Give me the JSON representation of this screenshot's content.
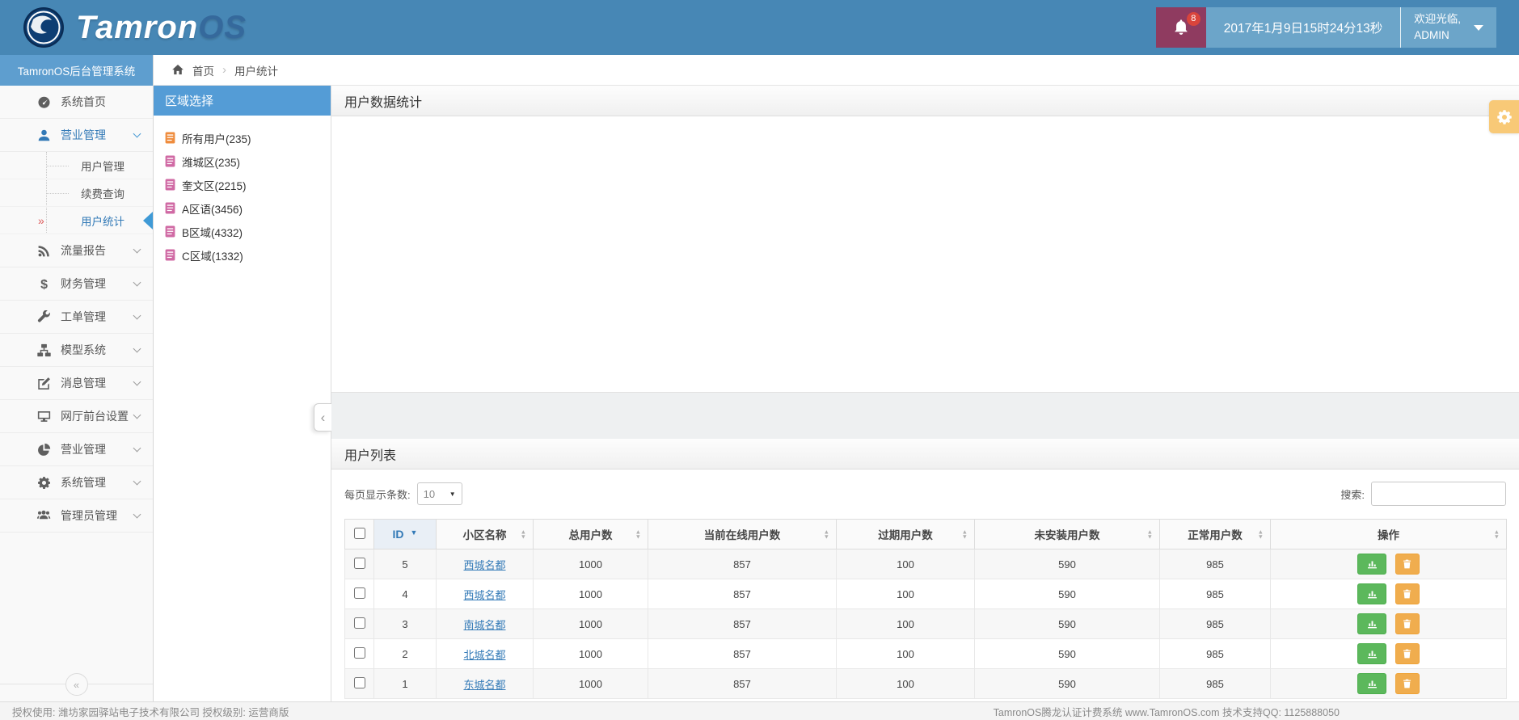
{
  "header": {
    "logo": {
      "part1": "Tamron",
      "part2": "OS"
    },
    "notifications": {
      "count": "8"
    },
    "datetime": "2017年1月9日15时24分13秒",
    "welcome": {
      "line1": "欢迎光临,",
      "line2": "ADMIN"
    }
  },
  "sidebar": {
    "title": "TamronOS后台管理系统",
    "active_marker": "»",
    "collapse_glyph": "«",
    "items": [
      {
        "icon": "speedometer-icon",
        "label": "系统首页"
      },
      {
        "icon": "user-icon",
        "label": "营业管理",
        "state": "expanded"
      },
      {
        "label": "用户管理",
        "sub": true
      },
      {
        "label": "续费查询",
        "sub": true
      },
      {
        "label": "用户统计",
        "sub": true,
        "active": true
      },
      {
        "icon": "rss-icon",
        "label": "流量报告"
      },
      {
        "icon": "dollar-icon",
        "label": "财务管理"
      },
      {
        "icon": "wrench-icon",
        "label": "工单管理"
      },
      {
        "icon": "sitemap-icon",
        "label": "模型系统"
      },
      {
        "icon": "edit-icon",
        "label": "消息管理"
      },
      {
        "icon": "desktop-icon",
        "label": "网厅前台设置"
      },
      {
        "icon": "pie-icon",
        "label": "营业管理"
      },
      {
        "icon": "gears-icon",
        "label": "系统管理"
      },
      {
        "icon": "users-icon",
        "label": "管理员管理"
      }
    ]
  },
  "breadcrumb": {
    "home": "首页",
    "separator": "›",
    "current": "用户统计"
  },
  "region_panel": {
    "title": "区域选择",
    "items": [
      {
        "label": "所有用户(235)",
        "icon_color": "#ef8c3d"
      },
      {
        "label": "潍城区(235)",
        "icon_color": "#d06aa4"
      },
      {
        "label": "奎文区(2215)",
        "icon_color": "#d06aa4"
      },
      {
        "label": "A区语(3456)",
        "icon_color": "#d06aa4"
      },
      {
        "label": "B区域(4332)",
        "icon_color": "#d06aa4"
      },
      {
        "label": "C区域(1332)",
        "icon_color": "#d06aa4"
      }
    ]
  },
  "stats_panel": {
    "title": "用户数据统计"
  },
  "list_panel": {
    "title": "用户列表",
    "page_size_label": "每页显示条数:",
    "page_size_value": "10",
    "search_label": "搜索:",
    "columns": [
      "ID",
      "小区名称",
      "总用户数",
      "当前在线用户数",
      "过期用户数",
      "未安装用户数",
      "正常用户数",
      "操作"
    ],
    "rows": [
      {
        "id": "5",
        "name": "西城名都",
        "total": "1000",
        "online": "857",
        "expired": "100",
        "uninstalled": "590",
        "normal": "985"
      },
      {
        "id": "4",
        "name": "西城名都",
        "total": "1000",
        "online": "857",
        "expired": "100",
        "uninstalled": "590",
        "normal": "985"
      },
      {
        "id": "3",
        "name": "南城名都",
        "total": "1000",
        "online": "857",
        "expired": "100",
        "uninstalled": "590",
        "normal": "985"
      },
      {
        "id": "2",
        "name": "北城名都",
        "total": "1000",
        "online": "857",
        "expired": "100",
        "uninstalled": "590",
        "normal": "985"
      },
      {
        "id": "1",
        "name": "东城名都",
        "total": "1000",
        "online": "857",
        "expired": "100",
        "uninstalled": "590",
        "normal": "985"
      }
    ]
  },
  "footer": {
    "left": "授权使用: 潍坊家园驿站电子技术有限公司  授权级别: 运营商版",
    "right": "TamronOS腾龙认证计费系统 www.TamronOS.com 技术支持QQ: 1125888050"
  },
  "glyphs": {
    "sort_up": "▲",
    "sort_down": "▼",
    "select_caret": "▼",
    "panel_collapse": "‹"
  },
  "colors": {
    "navbar": "#4787b5",
    "top_box_blue": "#6ca5c9",
    "notification_maroon": "#8f3b60",
    "badge_red": "#d9443c",
    "header_blue": "#549cd6",
    "accent": "#337ab7",
    "green_button": "#5cb85c",
    "orange_button": "#f0ad4e",
    "gear_tab_orange": "#f8c977",
    "active_marker_red": "#dd5a5a"
  }
}
